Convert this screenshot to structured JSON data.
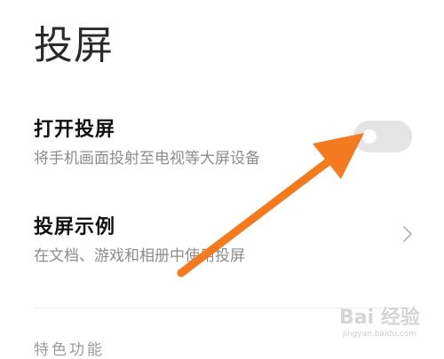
{
  "page": {
    "title": "投屏"
  },
  "settings": [
    {
      "title": "打开投屏",
      "subtitle": "将手机画面投射至电视等大屏设备",
      "control": "toggle",
      "toggle_on": false
    },
    {
      "title": "投屏示例",
      "subtitle": "在文档、游戏和相册中使用投屏",
      "control": "chevron-right-icon"
    }
  ],
  "section_header": "特色功能",
  "watermark": {
    "text": "Bai 经验",
    "url": "jingyan.baidu.com"
  },
  "colors": {
    "arrow": "#f47a20",
    "toggle_off": "#e4e4e4",
    "subtitle": "#8c8c8c"
  }
}
